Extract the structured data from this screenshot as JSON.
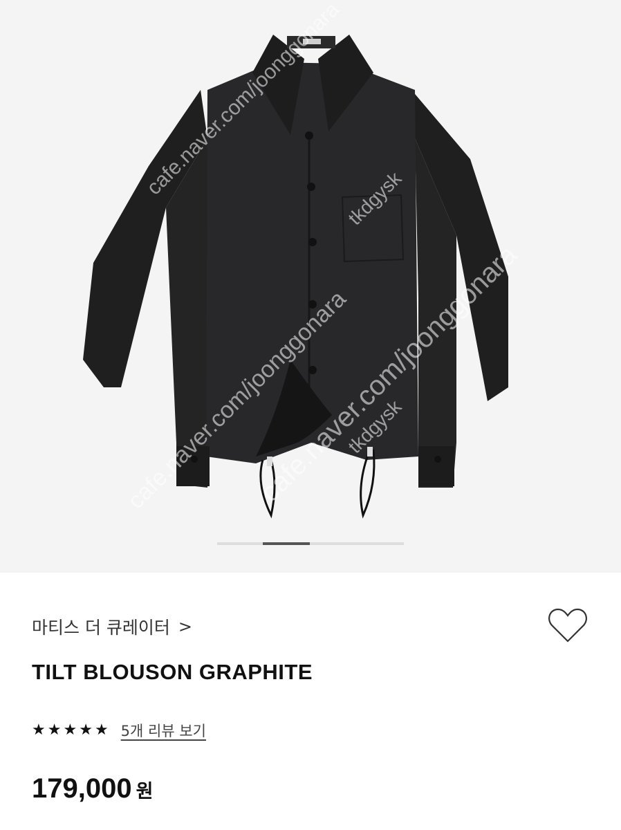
{
  "product_image": {
    "alt": "black drawstring shirt jacket",
    "watermarks": [
      "cafe.naver.com/joonggonara",
      "tkdgysk",
      "cafe.naver.com/joonggonara",
      "tkdgysk",
      "cafe.naver.com/joonggonara"
    ],
    "carousel": {
      "total": 4,
      "active_index": 1
    }
  },
  "brand": {
    "name": "마티스 더 큐레이터",
    "chevron": ">"
  },
  "wishlist_icon": "heart-outline-icon",
  "product": {
    "title": "TILT BLOUSON GRAPHITE",
    "rating": 5,
    "rating_max": 5,
    "review_link": "5개 리뷰 보기",
    "price": "179,000",
    "currency": "원"
  },
  "colors": {
    "star": "#111111",
    "background": "#ffffff",
    "hero_bg": "#f4f4f4"
  }
}
